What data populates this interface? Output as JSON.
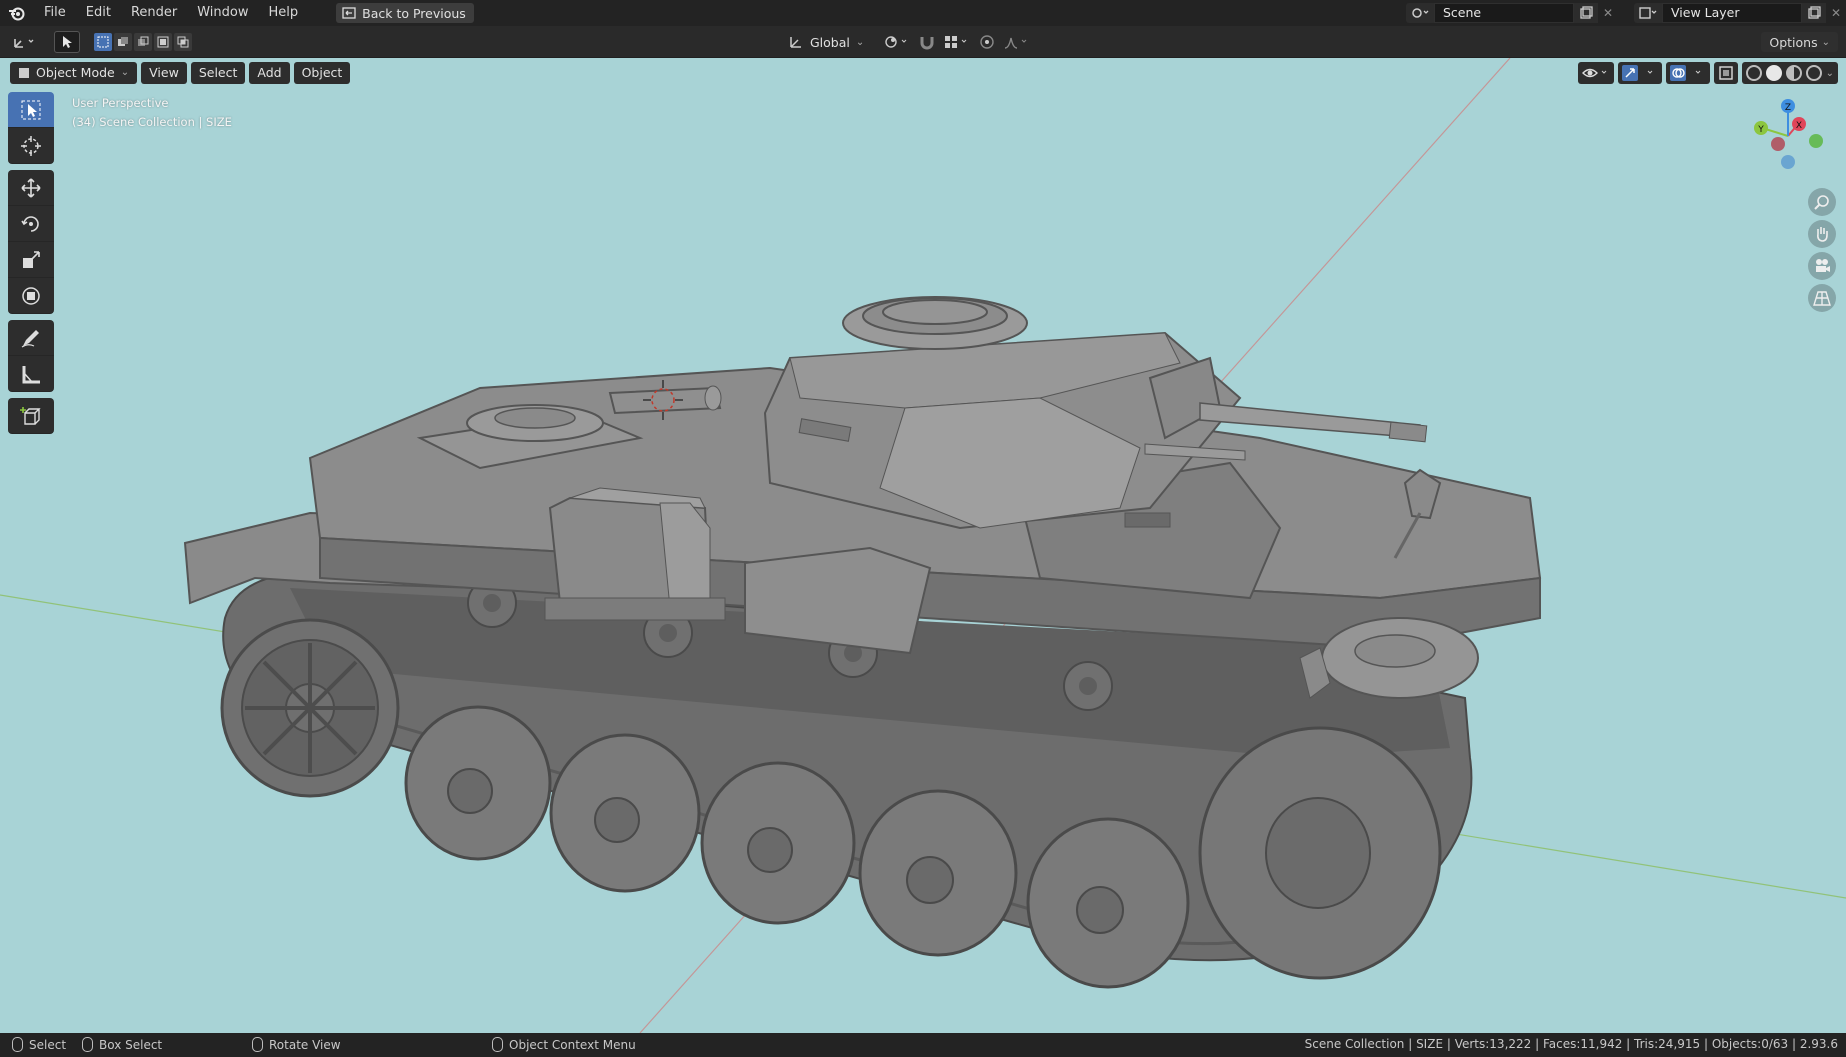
{
  "topbar": {
    "menu": [
      "File",
      "Edit",
      "Render",
      "Window",
      "Help"
    ],
    "back_label": "Back to Previous",
    "scene_label": "Scene",
    "view_layer_label": "View Layer"
  },
  "toolheader": {
    "orientation": "Global",
    "options_label": "Options"
  },
  "viewport": {
    "mode_label": "Object Mode",
    "menu": [
      "View",
      "Select",
      "Add",
      "Object"
    ],
    "info_line1": "User Perspective",
    "info_line2": "(34) Scene Collection | SIZE",
    "background": "#a8d3d6",
    "gizmo_axes": {
      "x": "X",
      "y": "Y",
      "z": "Z"
    }
  },
  "statusbar": {
    "select": "Select",
    "box_select": "Box Select",
    "rotate_view": "Rotate View",
    "context_menu": "Object Context Menu",
    "stats": "Scene Collection | SIZE | Verts:13,222 | Faces:11,942 | Tris:24,915 | Objects:0/63 | 2.93.6"
  },
  "colors": {
    "accent": "#4772b3",
    "axis_x": "#e0455a",
    "axis_y": "#8cc63f",
    "axis_z": "#3e8ee0"
  }
}
